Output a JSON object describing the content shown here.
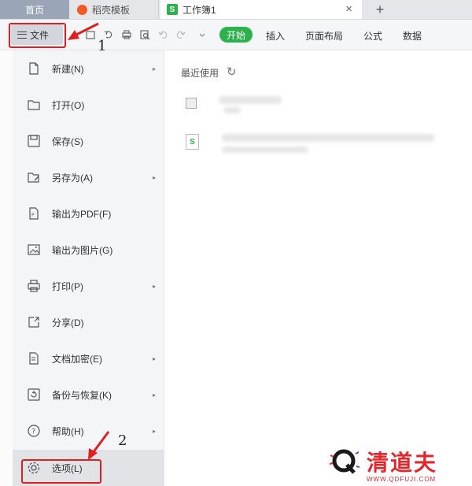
{
  "tabs": {
    "home": "首页",
    "template": "稻壳模板",
    "workbook": "工作簿1",
    "workbook_icon": "S",
    "close": "×",
    "new": "+"
  },
  "toolbar": {
    "file_label": "文件",
    "start_label": "开始",
    "menu_tabs": [
      "插入",
      "页面布局",
      "公式",
      "数据"
    ]
  },
  "file_menu": {
    "items": [
      {
        "label": "新建(N)",
        "icon": "new-file-icon",
        "submenu": true
      },
      {
        "label": "打开(O)",
        "icon": "folder-open-icon",
        "submenu": false
      },
      {
        "label": "保存(S)",
        "icon": "save-icon",
        "submenu": false
      },
      {
        "label": "另存为(A)",
        "icon": "save-as-icon",
        "submenu": true
      },
      {
        "label": "输出为PDF(F)",
        "icon": "pdf-icon",
        "submenu": false
      },
      {
        "label": "输出为图片(G)",
        "icon": "image-export-icon",
        "submenu": false
      },
      {
        "label": "打印(P)",
        "icon": "print-icon",
        "submenu": true
      },
      {
        "label": "分享(D)",
        "icon": "share-icon",
        "submenu": false
      },
      {
        "label": "文档加密(E)",
        "icon": "encrypt-icon",
        "submenu": true
      },
      {
        "label": "备份与恢复(K)",
        "icon": "backup-icon",
        "submenu": true
      },
      {
        "label": "帮助(H)",
        "icon": "help-icon",
        "submenu": true
      },
      {
        "label": "选项(L)",
        "icon": "gear-icon",
        "submenu": false
      }
    ],
    "arrow": "▸"
  },
  "recent": {
    "title": "最近使用",
    "refresh_icon": "↻",
    "file2_icon": "S"
  },
  "annotations": {
    "step1": "1",
    "step2": "2",
    "color": "#e02020"
  },
  "watermark": {
    "text": "清道夫",
    "sub": "WWW.QDFUJI.COM",
    "color": "#e6262d"
  },
  "colors": {
    "accent_green": "#2bb24c",
    "menu_bg": "#f4f5f7"
  }
}
